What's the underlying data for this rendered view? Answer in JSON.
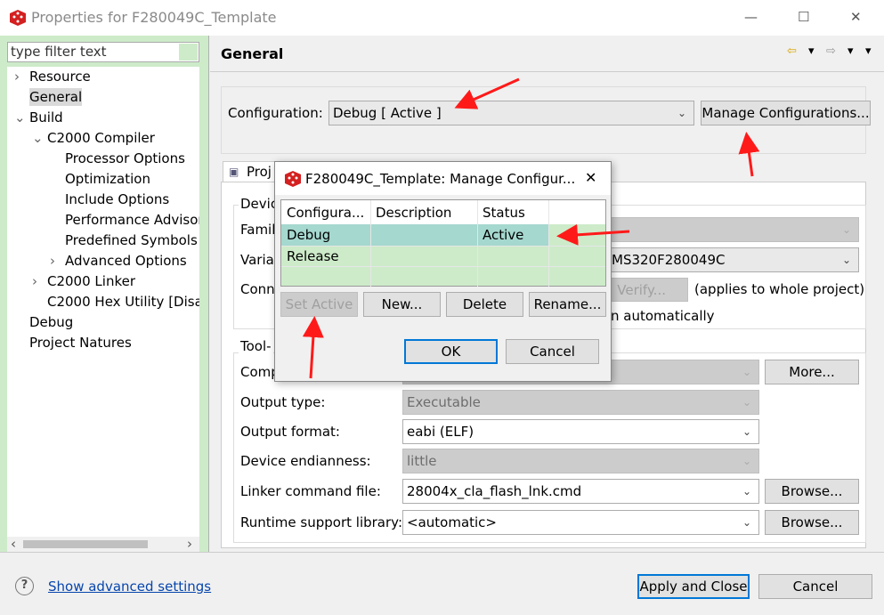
{
  "window": {
    "title": "Properties for F280049C_Template",
    "minimize": "—",
    "maximize": "☐",
    "close": "✕"
  },
  "sidebar": {
    "filter_placeholder": "type filter text",
    "items": [
      {
        "label": "Resource",
        "level": 0,
        "expander": "›"
      },
      {
        "label": "General",
        "level": 0,
        "selected": true
      },
      {
        "label": "Build",
        "level": 0,
        "expander": "⌄"
      },
      {
        "label": "C2000 Compiler",
        "level": 1,
        "expander": "⌄"
      },
      {
        "label": "Processor Options",
        "level": 2
      },
      {
        "label": "Optimization",
        "level": 2
      },
      {
        "label": "Include Options",
        "level": 2
      },
      {
        "label": "Performance Advisor",
        "level": 2
      },
      {
        "label": "Predefined Symbols",
        "level": 2
      },
      {
        "label": "Advanced Options",
        "level": 2,
        "expander": "›"
      },
      {
        "label": "C2000 Linker",
        "level": 1,
        "expander": "›"
      },
      {
        "label": "C2000 Hex Utility  [Disa",
        "level": 1
      },
      {
        "label": "Debug",
        "level": 0
      },
      {
        "label": "Project Natures",
        "level": 0
      }
    ]
  },
  "main": {
    "title": "General",
    "configuration_label": "Configuration:",
    "configuration_value": "Debug  [ Active ]",
    "manage_button": "Manage Configurations...",
    "tab_label": "Proj",
    "device_group": "Devic",
    "family_label": "Famil",
    "variant_label": "Varian",
    "variant_value": "MS320F280049C",
    "connection_label": "Conn",
    "verify_button": "Verify...",
    "applies_note": "(applies to whole project)",
    "auto_text": "n automatically",
    "toolchain_group": "Tool-",
    "compiler_label": "Comp",
    "more_button": "More...",
    "output_type_label": "Output type:",
    "output_type_value": "Executable",
    "output_format_label": "Output format:",
    "output_format_value": "eabi (ELF)",
    "endianness_label": "Device endianness:",
    "endianness_value": "little",
    "linker_cmd_label": "Linker command file:",
    "linker_cmd_value": "28004x_cla_flash_lnk.cmd",
    "browse_button": "Browse...",
    "runtime_label": "Runtime support library:",
    "runtime_value": "<automatic>"
  },
  "footer": {
    "help_icon": "?",
    "advanced_link": "Show advanced settings",
    "apply_close": "Apply and Close",
    "cancel": "Cancel"
  },
  "dialog": {
    "title": "F280049C_Template: Manage Configur...",
    "columns": [
      "Configura...",
      "Description",
      "Status",
      ""
    ],
    "rows": [
      [
        "Debug",
        "",
        "Active",
        ""
      ],
      [
        "Release",
        "",
        "",
        ""
      ]
    ],
    "set_active": "Set Active",
    "new": "New...",
    "delete": "Delete",
    "rename": "Rename...",
    "ok": "OK",
    "cancel": "Cancel"
  },
  "colors": {
    "sidebar_bg": "#cdebc9",
    "selected_row": "#a5d8cf",
    "table_bg": "#cdebc9",
    "annotation_arrow": "#ff1a1a",
    "focus": "#0078d7"
  }
}
